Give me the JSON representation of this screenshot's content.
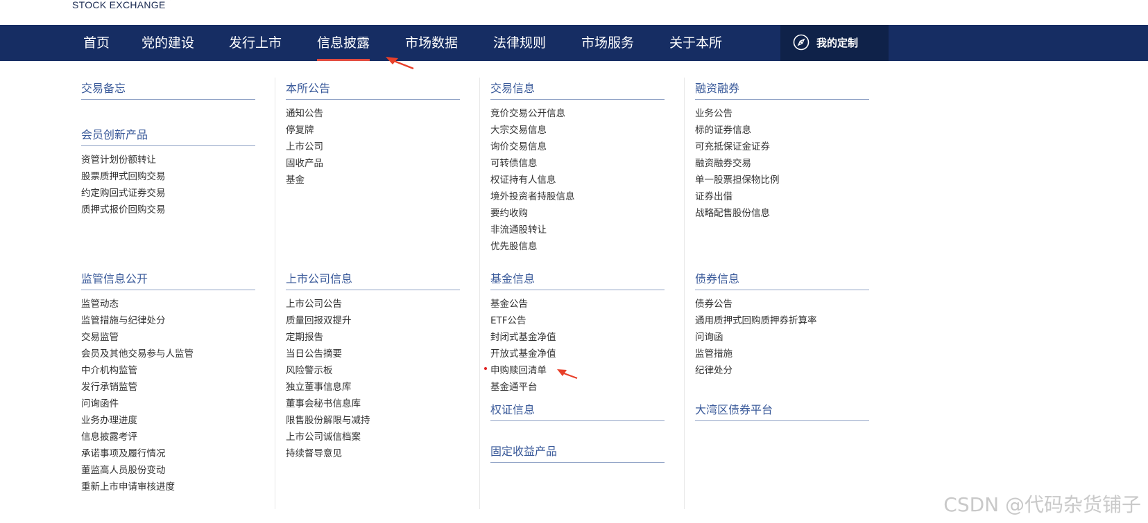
{
  "logo": {
    "text": "STOCK EXCHANGE",
    "caret": "›"
  },
  "nav": {
    "items": [
      "首页",
      "党的建设",
      "发行上市",
      "信息披露",
      "市场数据",
      "法律规则",
      "市场服务",
      "关于本所"
    ],
    "active_index": 3,
    "custom_label": "我的定制"
  },
  "menu": {
    "col1": {
      "s1": {
        "title": "交易备忘",
        "items": []
      },
      "s2": {
        "title": "会员创新产品",
        "items": [
          "资管计划份额转让",
          "股票质押式回购交易",
          "约定购回式证券交易",
          "质押式报价回购交易"
        ]
      },
      "s3": {
        "title": "监管信息公开",
        "items": [
          "监管动态",
          "监管措施与纪律处分",
          "交易监管",
          "会员及其他交易参与人监管",
          "中介机构监管",
          "发行承销监管",
          "问询函件",
          "业务办理进度",
          "信息披露考评",
          "承诺事项及履行情况",
          "董监高人员股份变动",
          "重新上市申请审核进度"
        ]
      }
    },
    "col2": {
      "s1": {
        "title": "本所公告",
        "items": [
          "通知公告",
          "停复牌",
          "上市公司",
          "固收产品",
          "基金"
        ]
      },
      "s2": {
        "title": "上市公司信息",
        "items": [
          "上市公司公告",
          "质量回报双提升",
          "定期报告",
          "当日公告摘要",
          "风险警示板",
          "独立董事信息库",
          "董事会秘书信息库",
          "限售股份解限与减持",
          "上市公司诚信档案",
          "持续督导意见"
        ]
      }
    },
    "col3": {
      "s1": {
        "title": "交易信息",
        "items": [
          "竞价交易公开信息",
          "大宗交易信息",
          "询价交易信息",
          "可转债信息",
          "权证持有人信息",
          "境外投资者持股信息",
          "要约收购",
          "非流通股转让",
          "优先股信息"
        ]
      },
      "s2": {
        "title": "基金信息",
        "items": [
          "基金公告",
          "ETF公告",
          "封闭式基金净值",
          "开放式基金净值",
          "申购赎回清单",
          "基金通平台"
        ]
      },
      "s3": {
        "title": "权证信息",
        "items": []
      },
      "s4": {
        "title": "固定收益产品",
        "items": []
      }
    },
    "col4": {
      "s1": {
        "title": "融资融券",
        "items": [
          "业务公告",
          "标的证券信息",
          "可充抵保证金证券",
          "融资融券交易",
          "单一股票担保物比例",
          "证券出借",
          "战略配售股份信息"
        ]
      },
      "s2": {
        "title": "债券信息",
        "items": [
          "债券公告",
          "通用质押式回购质押券折算率",
          "问询函",
          "监管措施",
          "纪律处分"
        ]
      },
      "s3": {
        "title": "大湾区债券平台",
        "items": []
      }
    }
  },
  "colors": {
    "nav_bg": "#162d63",
    "active_underline": "#e34b3f",
    "title": "#3a5a9a",
    "arrow": "#e8402a"
  },
  "watermark": "CSDN @代码杂货铺子"
}
